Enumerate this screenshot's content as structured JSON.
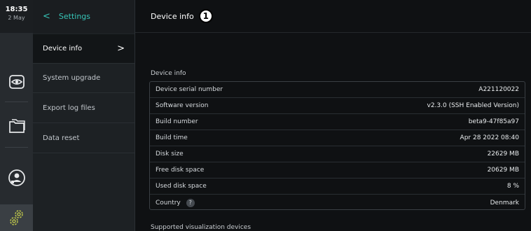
{
  "status": {
    "time": "18:35",
    "date": "2 May"
  },
  "nav": {
    "back_glyph": "<",
    "title": "Settings",
    "items": [
      {
        "label": "Device info",
        "active": true
      },
      {
        "label": "System upgrade"
      },
      {
        "label": "Export log files"
      },
      {
        "label": "Data reset"
      }
    ],
    "chevron_glyph": ">"
  },
  "header": {
    "title": "Device info",
    "callout": "1"
  },
  "device_info": {
    "section_label": "Device info",
    "rows": [
      {
        "key": "Device serial number",
        "value": "A221120022"
      },
      {
        "key": "Software version",
        "value": "v2.3.0 (SSH Enabled Version)"
      },
      {
        "key": "Build number",
        "value": "beta9-47f85a97"
      },
      {
        "key": "Build time",
        "value": "Apr 28 2022 08:40"
      },
      {
        "key": "Disk size",
        "value": "22629 MB"
      },
      {
        "key": "Free disk space",
        "value": "20629 MB"
      },
      {
        "key": "Used disk space",
        "value": "8 %"
      },
      {
        "key": "Country",
        "value": "Denmark",
        "help": "?"
      }
    ]
  },
  "supported_section_label": "Supported visualization devices",
  "icons": {
    "rail": [
      "eye-icon",
      "folder-icon",
      "user-icon",
      "settings-gear-icon"
    ],
    "accent_color": "#36c4b6"
  }
}
